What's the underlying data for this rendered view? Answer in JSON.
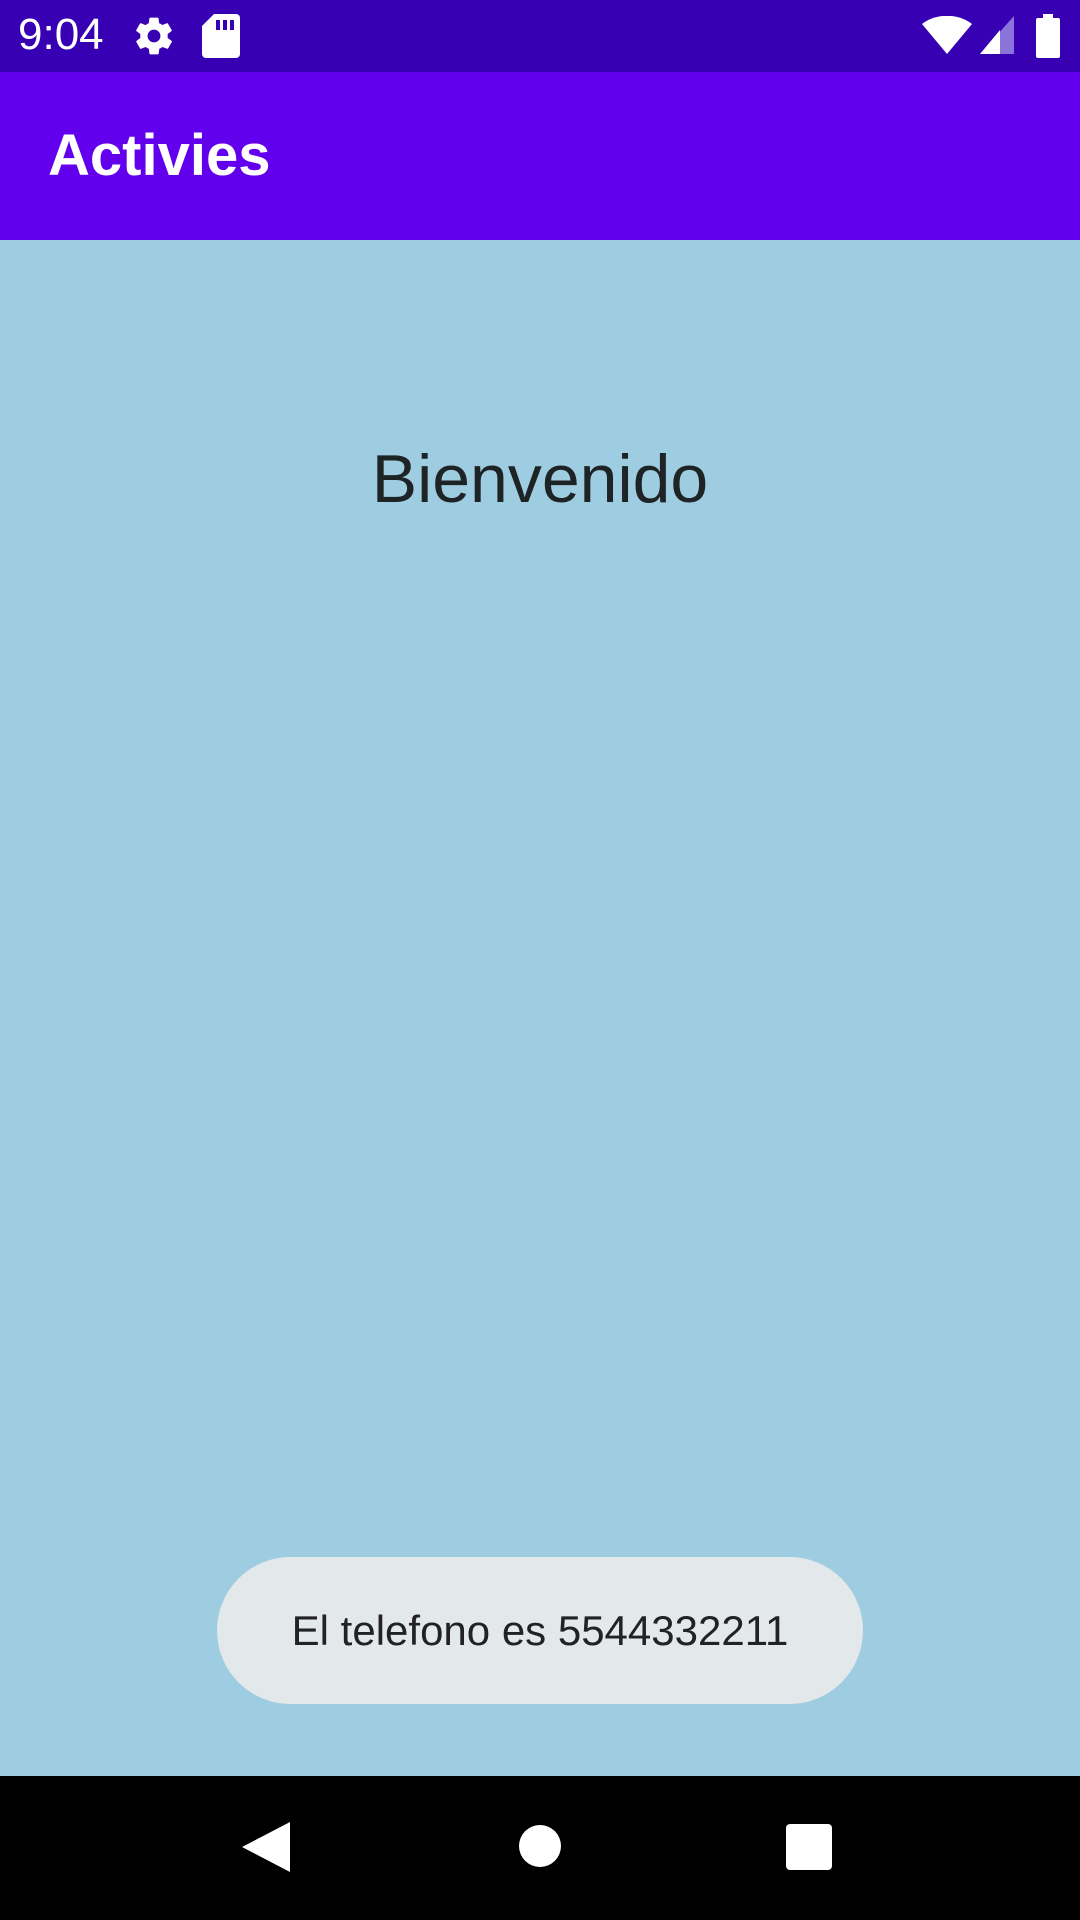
{
  "status_bar": {
    "time": "9:04",
    "icons": [
      "gear-icon",
      "sd-card-icon",
      "wifi-icon",
      "signal-icon",
      "battery-icon"
    ]
  },
  "app_bar": {
    "title": "Activies",
    "color": "#6200ee"
  },
  "main": {
    "welcome_text": "Bienvenido",
    "background": "#9ecde1"
  },
  "toast": {
    "message": "El telefono es 5544332211"
  },
  "nav_bar": {
    "buttons": [
      "back-icon",
      "home-icon",
      "recents-icon"
    ]
  }
}
